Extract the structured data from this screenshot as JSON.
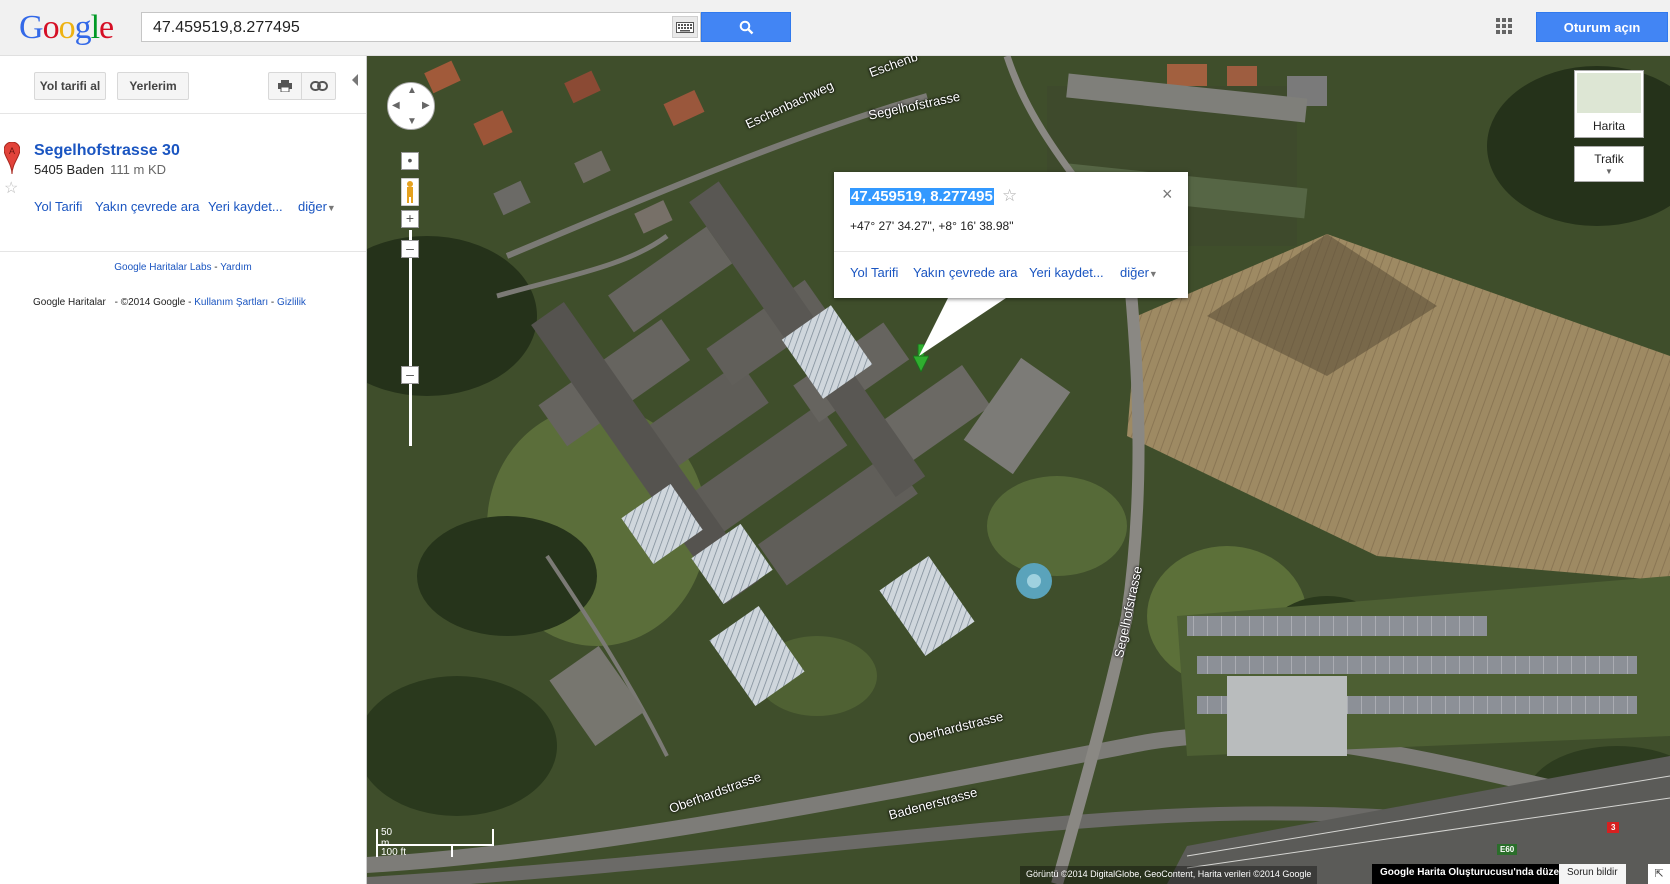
{
  "header": {
    "logo": [
      "G",
      "o",
      "o",
      "g",
      "l",
      "e"
    ],
    "logo_colors": [
      "#3369e8",
      "#d50f25",
      "#eeb211",
      "#3369e8",
      "#009925",
      "#d50f25"
    ],
    "search_value": "47.459519,8.277495",
    "signin_label": "Oturum açın",
    "icons": {
      "keyboard": "keyboard-icon",
      "search": "search-icon",
      "apps": "apps-grid-icon"
    }
  },
  "sidebar": {
    "directions_btn": "Yol tarifi al",
    "my_places_btn": "Yerlerim",
    "icons": {
      "print": "print-icon",
      "link": "link-icon",
      "collapse": "collapse-arrow-icon"
    },
    "result": {
      "marker_letter": "A",
      "title": "Segelhofstrasse 30",
      "address": "5405 Baden",
      "distance": "111 m KD",
      "actions": [
        "Yol Tarifi",
        "Yakın çevrede ara",
        "Yeri kaydet...",
        "diğer"
      ]
    },
    "footer": {
      "labs": "Google Haritalar Labs",
      "sep": " - ",
      "help": "Yardım",
      "brand": "Google Haritalar",
      "copyright": " - ©2014 Google",
      "terms": "Kullanım Şartları",
      "privacy": "Gizlilik"
    }
  },
  "map": {
    "layer_label": "Harita",
    "traffic_label": "Trafik",
    "streets": [
      "Eschenbachweg",
      "Segelhofstrasse",
      "Segelhofstrasse",
      "Oberhardstrasse",
      "Oberhardstrasse",
      "Badenerstrasse",
      "Eschenb"
    ],
    "marker_letter": "A",
    "info": {
      "title": "47.459519, 8.277495",
      "dms": "+47° 27' 34.27\", +8° 16' 38.98\"",
      "actions": [
        "Yol Tarifi",
        "Yakın çevrede ara",
        "Yeri kaydet...",
        "diğer"
      ]
    },
    "scale": {
      "metric": "50 m",
      "imperial": "100 ft"
    },
    "attribution": "Görüntü ©2014 DigitalGlobe, GeoContent, Harita verileri ©2014 Google",
    "mapmaker_link": "Google Harita Oluşturucusu'nda düzenle",
    "report_label": "Sorun bildir",
    "road_badges": [
      "E60",
      "3"
    ]
  }
}
